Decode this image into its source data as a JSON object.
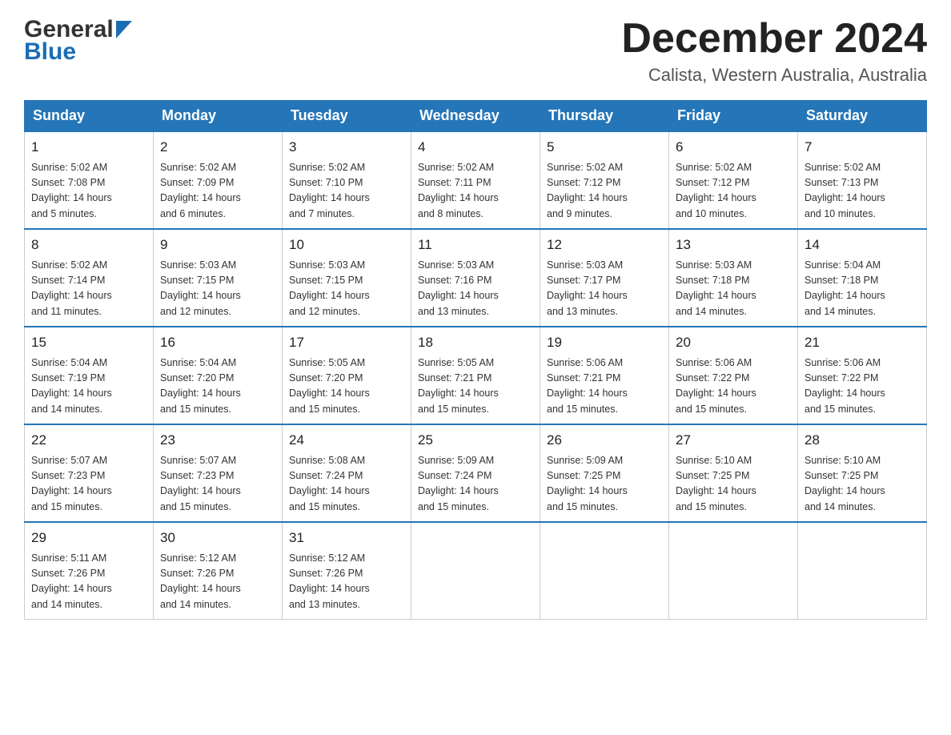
{
  "header": {
    "logo_general": "General",
    "logo_blue": "Blue",
    "month_title": "December 2024",
    "location": "Calista, Western Australia, Australia"
  },
  "days_of_week": [
    "Sunday",
    "Monday",
    "Tuesday",
    "Wednesday",
    "Thursday",
    "Friday",
    "Saturday"
  ],
  "weeks": [
    [
      {
        "day": "1",
        "sunrise": "5:02 AM",
        "sunset": "7:08 PM",
        "daylight": "14 hours and 5 minutes."
      },
      {
        "day": "2",
        "sunrise": "5:02 AM",
        "sunset": "7:09 PM",
        "daylight": "14 hours and 6 minutes."
      },
      {
        "day": "3",
        "sunrise": "5:02 AM",
        "sunset": "7:10 PM",
        "daylight": "14 hours and 7 minutes."
      },
      {
        "day": "4",
        "sunrise": "5:02 AM",
        "sunset": "7:11 PM",
        "daylight": "14 hours and 8 minutes."
      },
      {
        "day": "5",
        "sunrise": "5:02 AM",
        "sunset": "7:12 PM",
        "daylight": "14 hours and 9 minutes."
      },
      {
        "day": "6",
        "sunrise": "5:02 AM",
        "sunset": "7:12 PM",
        "daylight": "14 hours and 10 minutes."
      },
      {
        "day": "7",
        "sunrise": "5:02 AM",
        "sunset": "7:13 PM",
        "daylight": "14 hours and 10 minutes."
      }
    ],
    [
      {
        "day": "8",
        "sunrise": "5:02 AM",
        "sunset": "7:14 PM",
        "daylight": "14 hours and 11 minutes."
      },
      {
        "day": "9",
        "sunrise": "5:03 AM",
        "sunset": "7:15 PM",
        "daylight": "14 hours and 12 minutes."
      },
      {
        "day": "10",
        "sunrise": "5:03 AM",
        "sunset": "7:15 PM",
        "daylight": "14 hours and 12 minutes."
      },
      {
        "day": "11",
        "sunrise": "5:03 AM",
        "sunset": "7:16 PM",
        "daylight": "14 hours and 13 minutes."
      },
      {
        "day": "12",
        "sunrise": "5:03 AM",
        "sunset": "7:17 PM",
        "daylight": "14 hours and 13 minutes."
      },
      {
        "day": "13",
        "sunrise": "5:03 AM",
        "sunset": "7:18 PM",
        "daylight": "14 hours and 14 minutes."
      },
      {
        "day": "14",
        "sunrise": "5:04 AM",
        "sunset": "7:18 PM",
        "daylight": "14 hours and 14 minutes."
      }
    ],
    [
      {
        "day": "15",
        "sunrise": "5:04 AM",
        "sunset": "7:19 PM",
        "daylight": "14 hours and 14 minutes."
      },
      {
        "day": "16",
        "sunrise": "5:04 AM",
        "sunset": "7:20 PM",
        "daylight": "14 hours and 15 minutes."
      },
      {
        "day": "17",
        "sunrise": "5:05 AM",
        "sunset": "7:20 PM",
        "daylight": "14 hours and 15 minutes."
      },
      {
        "day": "18",
        "sunrise": "5:05 AM",
        "sunset": "7:21 PM",
        "daylight": "14 hours and 15 minutes."
      },
      {
        "day": "19",
        "sunrise": "5:06 AM",
        "sunset": "7:21 PM",
        "daylight": "14 hours and 15 minutes."
      },
      {
        "day": "20",
        "sunrise": "5:06 AM",
        "sunset": "7:22 PM",
        "daylight": "14 hours and 15 minutes."
      },
      {
        "day": "21",
        "sunrise": "5:06 AM",
        "sunset": "7:22 PM",
        "daylight": "14 hours and 15 minutes."
      }
    ],
    [
      {
        "day": "22",
        "sunrise": "5:07 AM",
        "sunset": "7:23 PM",
        "daylight": "14 hours and 15 minutes."
      },
      {
        "day": "23",
        "sunrise": "5:07 AM",
        "sunset": "7:23 PM",
        "daylight": "14 hours and 15 minutes."
      },
      {
        "day": "24",
        "sunrise": "5:08 AM",
        "sunset": "7:24 PM",
        "daylight": "14 hours and 15 minutes."
      },
      {
        "day": "25",
        "sunrise": "5:09 AM",
        "sunset": "7:24 PM",
        "daylight": "14 hours and 15 minutes."
      },
      {
        "day": "26",
        "sunrise": "5:09 AM",
        "sunset": "7:25 PM",
        "daylight": "14 hours and 15 minutes."
      },
      {
        "day": "27",
        "sunrise": "5:10 AM",
        "sunset": "7:25 PM",
        "daylight": "14 hours and 15 minutes."
      },
      {
        "day": "28",
        "sunrise": "5:10 AM",
        "sunset": "7:25 PM",
        "daylight": "14 hours and 14 minutes."
      }
    ],
    [
      {
        "day": "29",
        "sunrise": "5:11 AM",
        "sunset": "7:26 PM",
        "daylight": "14 hours and 14 minutes."
      },
      {
        "day": "30",
        "sunrise": "5:12 AM",
        "sunset": "7:26 PM",
        "daylight": "14 hours and 14 minutes."
      },
      {
        "day": "31",
        "sunrise": "5:12 AM",
        "sunset": "7:26 PM",
        "daylight": "14 hours and 13 minutes."
      },
      null,
      null,
      null,
      null
    ]
  ],
  "labels": {
    "sunrise": "Sunrise:",
    "sunset": "Sunset:",
    "daylight": "Daylight:"
  }
}
